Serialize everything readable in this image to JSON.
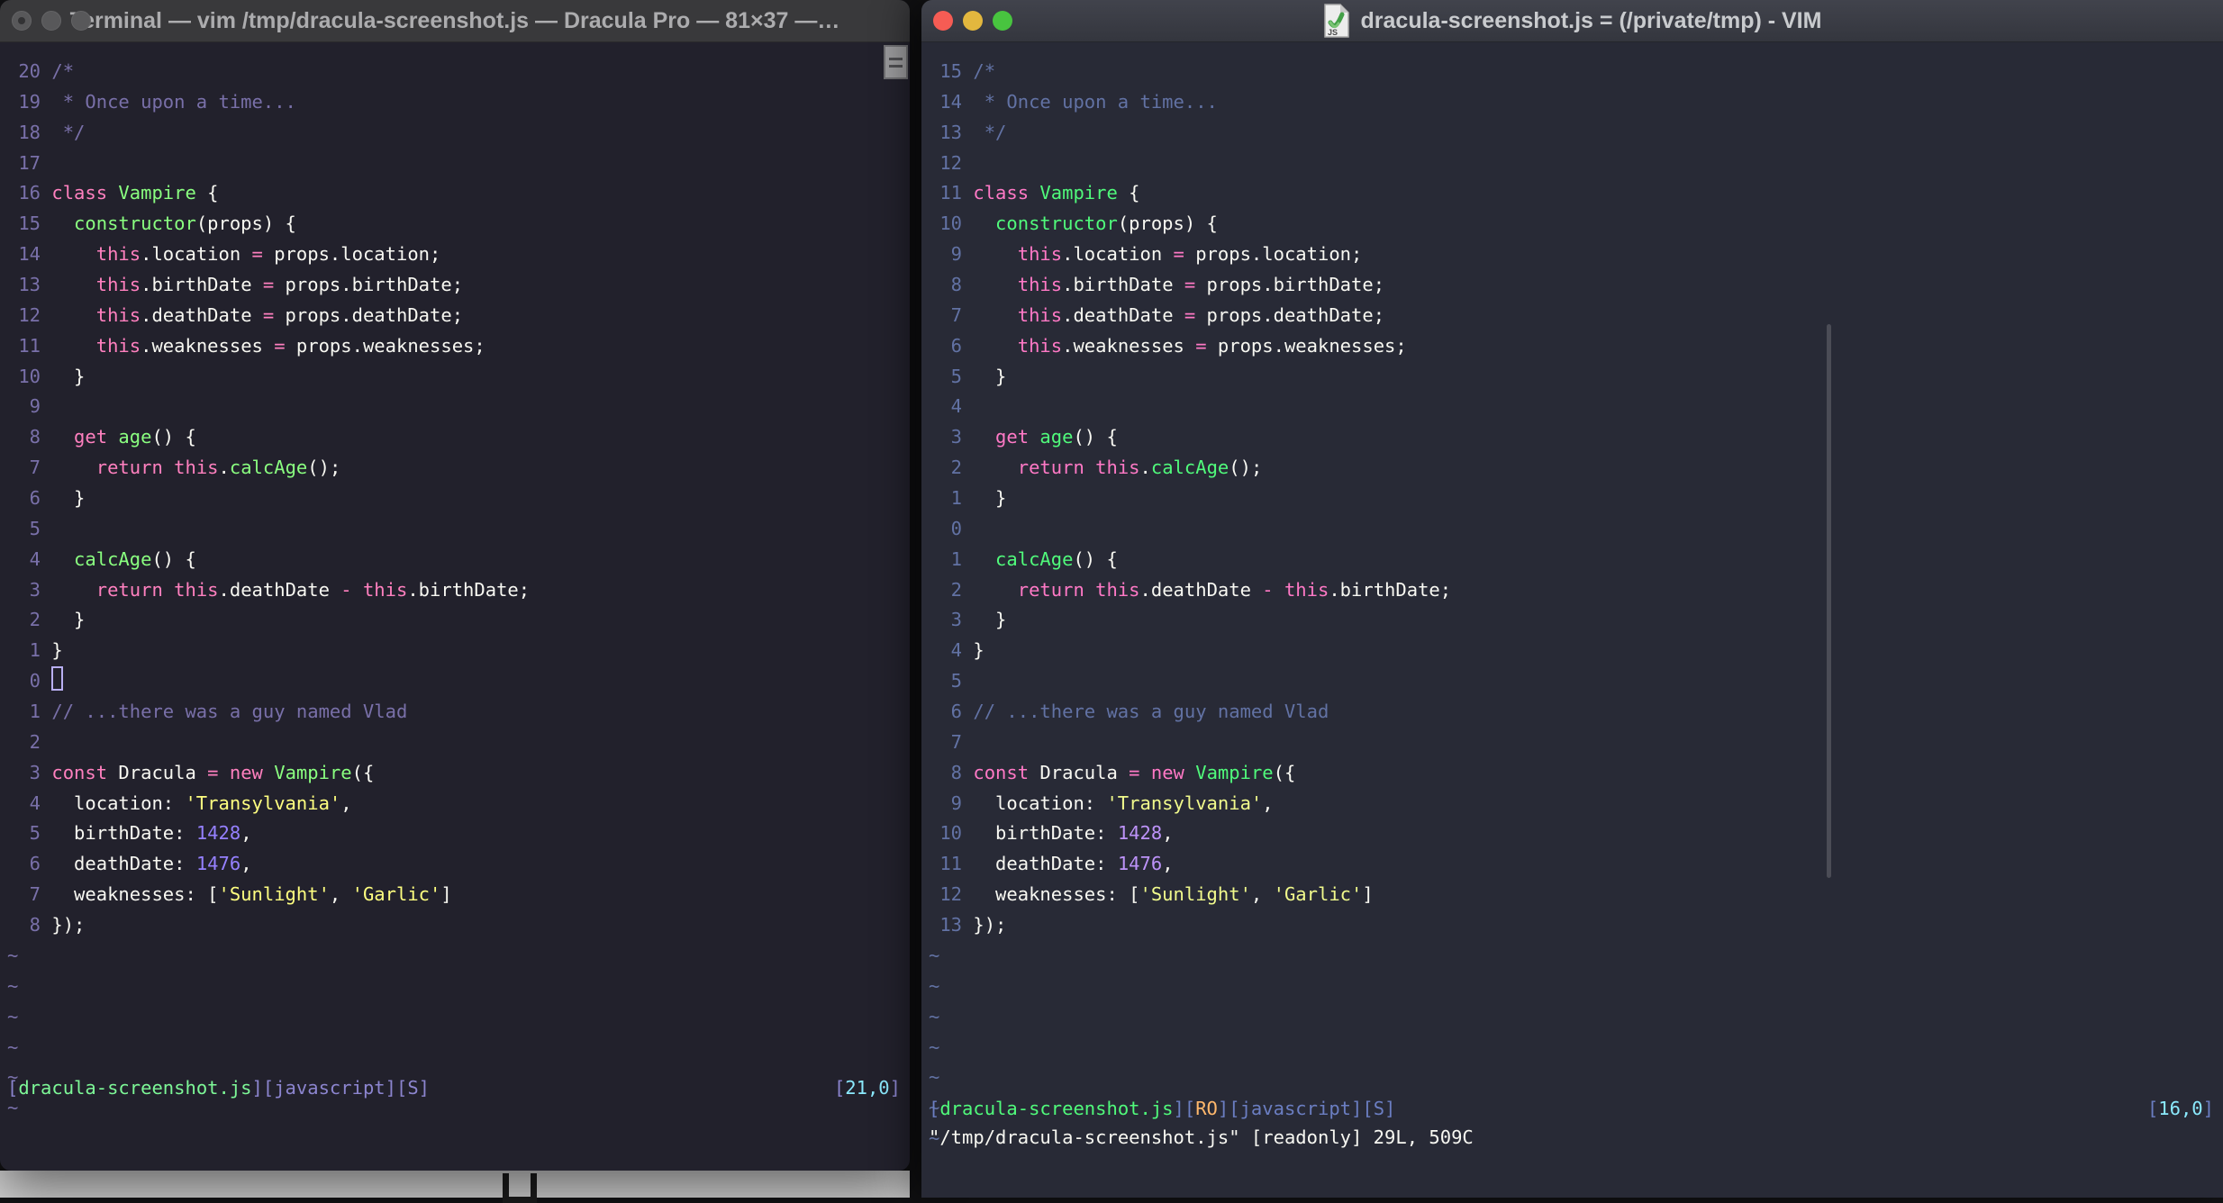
{
  "left_window": {
    "title": "Terminal — vim /tmp/dracula-screenshot.js — Dracula Pro — 81×37 —…",
    "lights": [
      "#58585A",
      "#58585A",
      "#58585A"
    ],
    "palette": {
      "bg": "#22212C",
      "f": "#F8F8F2",
      "c": "#7970A9",
      "p": "#FF80BF",
      "g": "#8AFF80",
      "y": "#FFFF80",
      "u": "#9580FF",
      "ln": "#7970A9",
      "sb": "#8C85CF",
      "sf": "#7DF797",
      "sp": "#8BE9FD",
      "cursor": "#B9AFF2"
    },
    "lines": [
      {
        "num": "20",
        "segs": [
          [
            "c",
            "/*"
          ]
        ]
      },
      {
        "num": "19",
        "segs": [
          [
            "c",
            " * Once upon a time..."
          ]
        ]
      },
      {
        "num": "18",
        "segs": [
          [
            "c",
            " */"
          ]
        ]
      },
      {
        "num": "17",
        "segs": []
      },
      {
        "num": "16",
        "segs": [
          [
            "p",
            "class"
          ],
          [
            "f",
            " "
          ],
          [
            "g",
            "Vampire"
          ],
          [
            "f",
            " {"
          ]
        ]
      },
      {
        "num": "15",
        "segs": [
          [
            "f",
            "  "
          ],
          [
            "g",
            "constructor"
          ],
          [
            "f",
            "(props) {"
          ]
        ]
      },
      {
        "num": "14",
        "segs": [
          [
            "f",
            "    "
          ],
          [
            "p",
            "this"
          ],
          [
            "f",
            ".location "
          ],
          [
            "p",
            "="
          ],
          [
            "f",
            " props.location;"
          ]
        ]
      },
      {
        "num": "13",
        "segs": [
          [
            "f",
            "    "
          ],
          [
            "p",
            "this"
          ],
          [
            "f",
            ".birthDate "
          ],
          [
            "p",
            "="
          ],
          [
            "f",
            " props.birthDate;"
          ]
        ]
      },
      {
        "num": "12",
        "segs": [
          [
            "f",
            "    "
          ],
          [
            "p",
            "this"
          ],
          [
            "f",
            ".deathDate "
          ],
          [
            "p",
            "="
          ],
          [
            "f",
            " props.deathDate;"
          ]
        ]
      },
      {
        "num": "11",
        "segs": [
          [
            "f",
            "    "
          ],
          [
            "p",
            "this"
          ],
          [
            "f",
            ".weaknesses "
          ],
          [
            "p",
            "="
          ],
          [
            "f",
            " props.weaknesses;"
          ]
        ]
      },
      {
        "num": "10",
        "segs": [
          [
            "f",
            "  }"
          ]
        ]
      },
      {
        "num": "9",
        "segs": []
      },
      {
        "num": "8",
        "segs": [
          [
            "f",
            "  "
          ],
          [
            "p",
            "get"
          ],
          [
            "f",
            " "
          ],
          [
            "g",
            "age"
          ],
          [
            "f",
            "() {"
          ]
        ]
      },
      {
        "num": "7",
        "segs": [
          [
            "f",
            "    "
          ],
          [
            "p",
            "return"
          ],
          [
            "f",
            " "
          ],
          [
            "p",
            "this"
          ],
          [
            "f",
            "."
          ],
          [
            "g",
            "calcAge"
          ],
          [
            "f",
            "();"
          ]
        ]
      },
      {
        "num": "6",
        "segs": [
          [
            "f",
            "  }"
          ]
        ]
      },
      {
        "num": "5",
        "segs": []
      },
      {
        "num": "4",
        "segs": [
          [
            "f",
            "  "
          ],
          [
            "g",
            "calcAge"
          ],
          [
            "f",
            "() {"
          ]
        ]
      },
      {
        "num": "3",
        "segs": [
          [
            "f",
            "    "
          ],
          [
            "p",
            "return"
          ],
          [
            "f",
            " "
          ],
          [
            "p",
            "this"
          ],
          [
            "f",
            ".deathDate "
          ],
          [
            "p",
            "-"
          ],
          [
            "f",
            " "
          ],
          [
            "p",
            "this"
          ],
          [
            "f",
            ".birthDate;"
          ]
        ]
      },
      {
        "num": "2",
        "segs": [
          [
            "f",
            "  }"
          ]
        ]
      },
      {
        "num": "1",
        "segs": [
          [
            "f",
            "}"
          ]
        ]
      },
      {
        "num": "0",
        "cursor": true,
        "segs": []
      },
      {
        "num": "1",
        "segs": [
          [
            "c",
            "// ...there was a guy named Vlad"
          ]
        ]
      },
      {
        "num": "2",
        "segs": []
      },
      {
        "num": "3",
        "segs": [
          [
            "p",
            "const"
          ],
          [
            "f",
            " Dracula "
          ],
          [
            "p",
            "="
          ],
          [
            "f",
            " "
          ],
          [
            "p",
            "new"
          ],
          [
            "f",
            " "
          ],
          [
            "g",
            "Vampire"
          ],
          [
            "f",
            "({"
          ]
        ]
      },
      {
        "num": "4",
        "segs": [
          [
            "f",
            "  location: "
          ],
          [
            "y",
            "'Transylvania'"
          ],
          [
            "f",
            ","
          ]
        ]
      },
      {
        "num": "5",
        "segs": [
          [
            "f",
            "  birthDate: "
          ],
          [
            "u",
            "1428"
          ],
          [
            "f",
            ","
          ]
        ]
      },
      {
        "num": "6",
        "segs": [
          [
            "f",
            "  deathDate: "
          ],
          [
            "u",
            "1476"
          ],
          [
            "f",
            ","
          ]
        ]
      },
      {
        "num": "7",
        "segs": [
          [
            "f",
            "  weaknesses: ["
          ],
          [
            "y",
            "'Sunlight'"
          ],
          [
            "f",
            ", "
          ],
          [
            "y",
            "'Garlic'"
          ],
          [
            "f",
            "]"
          ]
        ]
      },
      {
        "num": "8",
        "segs": [
          [
            "f",
            "});"
          ]
        ]
      }
    ],
    "tilde_count": 6,
    "status": {
      "segs": [
        [
          "sb",
          "["
        ],
        [
          "sf",
          "dracula-screenshot.js"
        ],
        [
          "sb",
          "][javascript][S]"
        ]
      ],
      "position": [
        [
          "sb",
          "["
        ],
        [
          "sp",
          "21,0"
        ],
        [
          "sb",
          "]"
        ]
      ]
    }
  },
  "right_window": {
    "title": "dracula-screenshot.js = (/private/tmp) - VIM",
    "lights": [
      "#F65C54",
      "#E3B73E",
      "#48C43F"
    ],
    "palette": {
      "bg": "#282A36",
      "f": "#F8F8F2",
      "c": "#6272A4",
      "p": "#FF79C6",
      "g": "#50FA7B",
      "y": "#F1FA8C",
      "u": "#BD93F9",
      "ln": "#6272A4",
      "sb": "#6B7EC2",
      "sf": "#50FA7B",
      "so": "#FFB86C",
      "sp": "#8BE9FD"
    },
    "lines": [
      {
        "num": "15",
        "segs": [
          [
            "c",
            "/*"
          ]
        ]
      },
      {
        "num": "14",
        "segs": [
          [
            "c",
            " * Once upon a time..."
          ]
        ]
      },
      {
        "num": "13",
        "segs": [
          [
            "c",
            " */"
          ]
        ]
      },
      {
        "num": "12",
        "segs": []
      },
      {
        "num": "11",
        "segs": [
          [
            "p",
            "class"
          ],
          [
            "f",
            " "
          ],
          [
            "g",
            "Vampire"
          ],
          [
            "f",
            " {"
          ]
        ]
      },
      {
        "num": "10",
        "segs": [
          [
            "f",
            "  "
          ],
          [
            "g",
            "constructor"
          ],
          [
            "f",
            "(props) {"
          ]
        ]
      },
      {
        "num": "9",
        "segs": [
          [
            "f",
            "    "
          ],
          [
            "p",
            "this"
          ],
          [
            "f",
            ".location "
          ],
          [
            "p",
            "="
          ],
          [
            "f",
            " props.location;"
          ]
        ]
      },
      {
        "num": "8",
        "segs": [
          [
            "f",
            "    "
          ],
          [
            "p",
            "this"
          ],
          [
            "f",
            ".birthDate "
          ],
          [
            "p",
            "="
          ],
          [
            "f",
            " props.birthDate;"
          ]
        ]
      },
      {
        "num": "7",
        "segs": [
          [
            "f",
            "    "
          ],
          [
            "p",
            "this"
          ],
          [
            "f",
            ".deathDate "
          ],
          [
            "p",
            "="
          ],
          [
            "f",
            " props.deathDate;"
          ]
        ]
      },
      {
        "num": "6",
        "segs": [
          [
            "f",
            "    "
          ],
          [
            "p",
            "this"
          ],
          [
            "f",
            ".weaknesses "
          ],
          [
            "p",
            "="
          ],
          [
            "f",
            " props.weaknesses;"
          ]
        ]
      },
      {
        "num": "5",
        "segs": [
          [
            "f",
            "  }"
          ]
        ]
      },
      {
        "num": "4",
        "segs": []
      },
      {
        "num": "3",
        "segs": [
          [
            "f",
            "  "
          ],
          [
            "p",
            "get"
          ],
          [
            "f",
            " "
          ],
          [
            "g",
            "age"
          ],
          [
            "f",
            "() {"
          ]
        ]
      },
      {
        "num": "2",
        "segs": [
          [
            "f",
            "    "
          ],
          [
            "p",
            "return"
          ],
          [
            "f",
            " "
          ],
          [
            "p",
            "this"
          ],
          [
            "f",
            "."
          ],
          [
            "g",
            "calcAge"
          ],
          [
            "f",
            "();"
          ]
        ]
      },
      {
        "num": "1",
        "segs": [
          [
            "f",
            "  }"
          ]
        ]
      },
      {
        "num": "0",
        "segs": []
      },
      {
        "num": "1",
        "segs": [
          [
            "f",
            "  "
          ],
          [
            "g",
            "calcAge"
          ],
          [
            "f",
            "() {"
          ]
        ]
      },
      {
        "num": "2",
        "segs": [
          [
            "f",
            "    "
          ],
          [
            "p",
            "return"
          ],
          [
            "f",
            " "
          ],
          [
            "p",
            "this"
          ],
          [
            "f",
            ".deathDate "
          ],
          [
            "p",
            "-"
          ],
          [
            "f",
            " "
          ],
          [
            "p",
            "this"
          ],
          [
            "f",
            ".birthDate;"
          ]
        ]
      },
      {
        "num": "3",
        "segs": [
          [
            "f",
            "  }"
          ]
        ]
      },
      {
        "num": "4",
        "segs": [
          [
            "f",
            "}"
          ]
        ]
      },
      {
        "num": "5",
        "segs": []
      },
      {
        "num": "6",
        "segs": [
          [
            "c",
            "// ...there was a guy named Vlad"
          ]
        ]
      },
      {
        "num": "7",
        "segs": []
      },
      {
        "num": "8",
        "segs": [
          [
            "p",
            "const"
          ],
          [
            "f",
            " Dracula "
          ],
          [
            "p",
            "="
          ],
          [
            "f",
            " "
          ],
          [
            "p",
            "new"
          ],
          [
            "f",
            " "
          ],
          [
            "g",
            "Vampire"
          ],
          [
            "f",
            "({"
          ]
        ]
      },
      {
        "num": "9",
        "segs": [
          [
            "f",
            "  location: "
          ],
          [
            "y",
            "'Transylvania'"
          ],
          [
            "f",
            ","
          ]
        ]
      },
      {
        "num": "10",
        "segs": [
          [
            "f",
            "  birthDate: "
          ],
          [
            "u",
            "1428"
          ],
          [
            "f",
            ","
          ]
        ]
      },
      {
        "num": "11",
        "segs": [
          [
            "f",
            "  deathDate: "
          ],
          [
            "u",
            "1476"
          ],
          [
            "f",
            ","
          ]
        ]
      },
      {
        "num": "12",
        "segs": [
          [
            "f",
            "  weaknesses: ["
          ],
          [
            "y",
            "'Sunlight'"
          ],
          [
            "f",
            ", "
          ],
          [
            "y",
            "'Garlic'"
          ],
          [
            "f",
            "]"
          ]
        ]
      },
      {
        "num": "13",
        "segs": [
          [
            "f",
            "});"
          ]
        ]
      }
    ],
    "tilde_count": 7,
    "status": {
      "segs": [
        [
          "sb",
          "["
        ],
        [
          "sf",
          "dracula-screenshot.js"
        ],
        [
          "sb",
          "]["
        ],
        [
          "so",
          "RO"
        ],
        [
          "sb",
          "][javascript][S]"
        ]
      ],
      "position": [
        [
          "sb",
          "["
        ],
        [
          "sp",
          "16,0"
        ],
        [
          "sb",
          "]"
        ]
      ]
    },
    "command_line": "\"/tmp/dracula-screenshot.js\" [readonly] 29L, 509C"
  },
  "background": {
    "strip_color": "#D4D4D4"
  }
}
